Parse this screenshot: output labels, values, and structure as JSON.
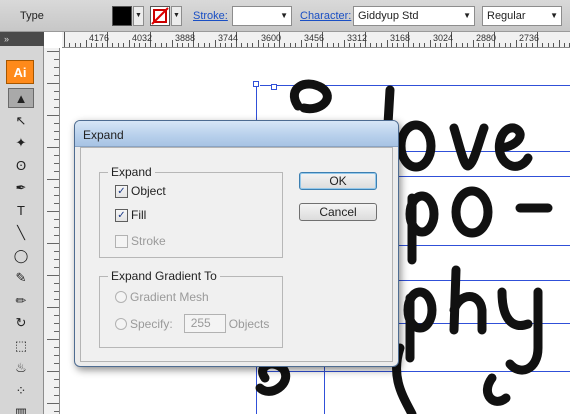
{
  "control_bar": {
    "mode_label": "Type",
    "fill_color": "#000000",
    "stroke_label": "Stroke:",
    "character_label": "Character:",
    "font_family": "Giddyup Std",
    "font_style": "Regular"
  },
  "ruler_labels": [
    "4176",
    "4032",
    "3888",
    "3744",
    "3600",
    "3456",
    "3312",
    "3168",
    "3024",
    "2880",
    "2736"
  ],
  "tools_panel": {
    "app_logo": "Ai",
    "collapse_glyph": "»",
    "tools": [
      {
        "name": "selection-tool",
        "glyph": "▲",
        "active": true
      },
      {
        "name": "direct-selection-tool",
        "glyph": "↖"
      },
      {
        "name": "magic-wand-tool",
        "glyph": "✦"
      },
      {
        "name": "lasso-tool",
        "glyph": "ʘ"
      },
      {
        "name": "pen-tool",
        "glyph": "✒"
      },
      {
        "name": "type-tool",
        "glyph": "T"
      },
      {
        "name": "line-segment-tool",
        "glyph": "╲"
      },
      {
        "name": "ellipse-tool",
        "glyph": "◯"
      },
      {
        "name": "paintbrush-tool",
        "glyph": "✎"
      },
      {
        "name": "pencil-tool",
        "glyph": "✏"
      },
      {
        "name": "rotate-tool",
        "glyph": "↻"
      },
      {
        "name": "scale-tool",
        "glyph": "⬚"
      },
      {
        "name": "warp-tool",
        "glyph": "♨"
      },
      {
        "name": "symbol-sprayer-tool",
        "glyph": "⁘"
      },
      {
        "name": "column-graph-tool",
        "glyph": "▥"
      }
    ]
  },
  "artwork": {
    "lines": [
      "I love",
      "po-",
      "phy"
    ],
    "color": "#000000"
  },
  "dialog": {
    "title": "Expand",
    "expand_group": {
      "label": "Expand",
      "object_label": "Object",
      "object_checked": true,
      "fill_label": "Fill",
      "fill_checked": true,
      "stroke_label": "Stroke",
      "stroke_checked": false
    },
    "gradient_group": {
      "label": "Expand Gradient To",
      "gradient_mesh_label": "Gradient Mesh",
      "specify_label": "Specify:",
      "specify_value": "255",
      "objects_label": "Objects"
    },
    "ok_label": "OK",
    "cancel_label": "Cancel"
  }
}
